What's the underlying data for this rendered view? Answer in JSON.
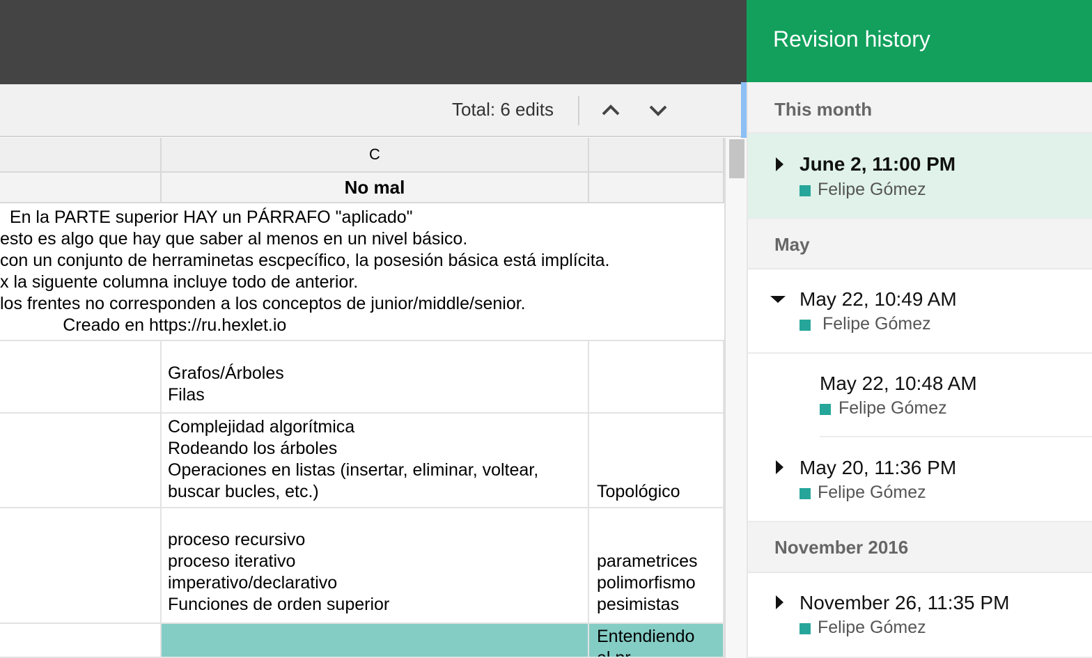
{
  "toolbar": {
    "total": "Total: 6 edits",
    "prev_icon": "chevron-up-icon",
    "next_icon": "chevron-down-icon"
  },
  "grid": {
    "column_header": "C",
    "header_row": "No mal",
    "row1": "  En la PARTE superior HAY un PÁRRAFO \"aplicado\"\nesto es algo que hay que saber al menos en un nivel básico.\ncon un conjunto de herraminetas escpecífico, la posesión básica está implícita.\nx la siguente columna incluye todo de anterior.\nlos frentes no corresponden a los conceptos de junior/middle/senior.\n             Creado en https://ru.hexlet.io",
    "row2_b": "Grafos/Árboles\nFilas",
    "row3_b": "Complejidad algorítmica\nRodeando los árboles\nOperaciones en listas (insertar, eliminar, voltear,\nbuscar bucles, etc.)",
    "row3_c": "Topológico",
    "row4_b": "proceso recursivo\nproceso iterativo\nimperativo/declarativo\nFunciones de orden superior",
    "row4_c": "parametrices\npolimorfismo\npesimistas",
    "row5_c": "Entendiendo\nel pr"
  },
  "revision_history": {
    "title": "Revision history",
    "groups": [
      {
        "label": "This month",
        "revisions": [
          {
            "date": "June 2, 11:00 PM",
            "user": "Felipe Gómez",
            "selected": true
          }
        ]
      },
      {
        "label": "May",
        "revisions": [
          {
            "date": "May 22, 10:49 AM",
            "user": "Felipe Gómez",
            "expanded": true
          },
          {
            "date": "May 22, 10:48 AM",
            "user": "Felipe Gómez"
          },
          {
            "date": "May 20, 11:36 PM",
            "user": "Felipe Gómez"
          }
        ]
      },
      {
        "label": "November 2016",
        "revisions": [
          {
            "date": "November 26, 11:35 PM",
            "user": "Felipe Gómez"
          }
        ]
      }
    ]
  },
  "colors": {
    "header_green": "#12a05c",
    "user_color": "#26a69a",
    "selected_bg": "#e0f2ea",
    "highlight_cell": "#84cdc5"
  }
}
